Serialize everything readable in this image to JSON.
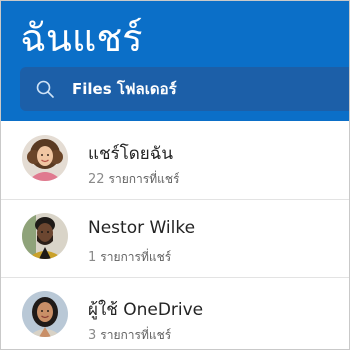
{
  "header": {
    "title": "ฉันแชร์",
    "background_color": "#0b6fc8"
  },
  "search": {
    "icon": "search-icon",
    "text": "Files โฟลเดอร์"
  },
  "people": [
    {
      "name": "แชร์โดยฉัน",
      "count": "22",
      "count_label": "รายการที่แชร์",
      "avatar": "avatar-woman-curly-hair"
    },
    {
      "name": "Nestor Wilke",
      "count": "1",
      "count_label": "รายการที่แชร์",
      "avatar": "avatar-man-beard"
    },
    {
      "name": "ผู้ใช้ OneDrive",
      "count": "3",
      "count_label": "รายการที่แชร์",
      "avatar": "avatar-woman-dark-hair"
    }
  ]
}
